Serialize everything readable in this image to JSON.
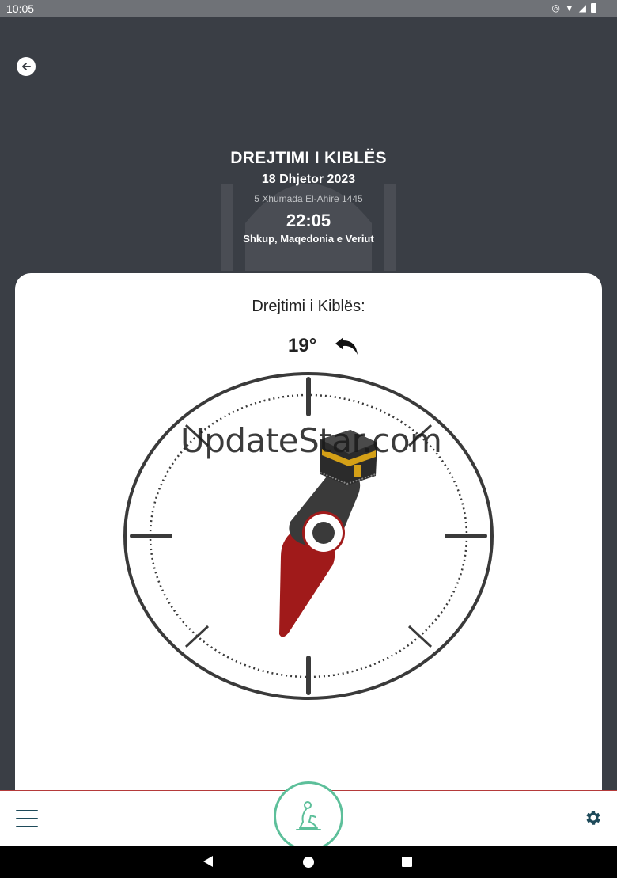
{
  "status_bar": {
    "time": "10:05"
  },
  "header": {
    "title": "DREJTIMI I KIBLËS",
    "date": "18 Dhjetor 2023",
    "hijri_date": "5 Xhumada El-Ahire 1445",
    "time": "22:05",
    "location": "Shkup, Maqedonia e Veriut"
  },
  "qibla": {
    "label": "Drejtimi i Kiblës:",
    "degree": "19°"
  },
  "watermark": "UpdateStar.com",
  "colors": {
    "header_bg": "#3a3e45",
    "needle_red": "#a01a1a",
    "needle_dark": "#3a3a3a",
    "accent_green": "#5dbf9a",
    "nav_icon": "#1e4a5a"
  },
  "icons": {
    "back": "arrow-left-icon",
    "turn": "turn-left-arrow-icon",
    "menu": "hamburger-menu-icon",
    "prayer": "praying-person-icon",
    "settings": "gear-icon"
  }
}
